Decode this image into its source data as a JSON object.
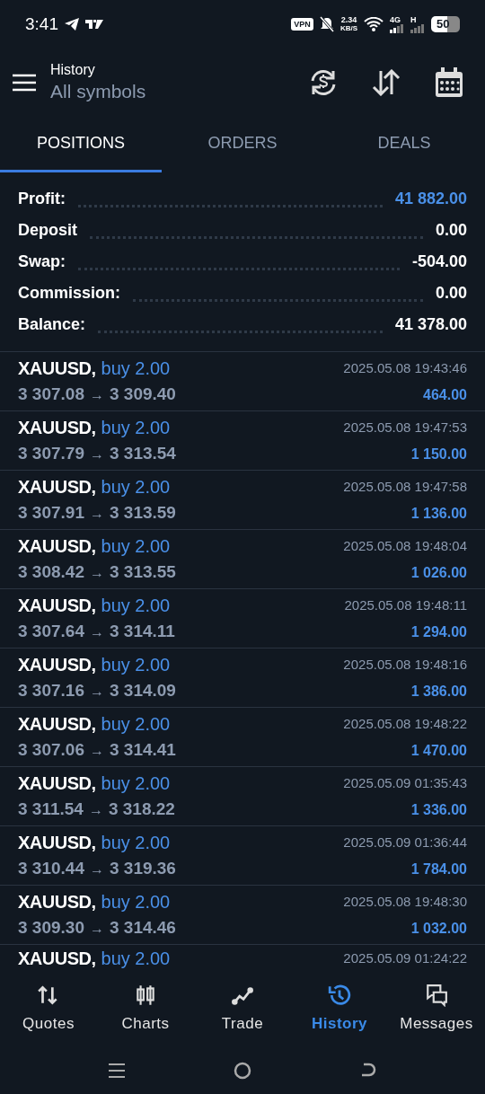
{
  "status_bar": {
    "time": "3:41",
    "vpn": "VPN",
    "speed": "2.34",
    "speed_unit": "KB/S",
    "network_1": "4G",
    "network_2": "H",
    "battery": "50"
  },
  "header": {
    "subtitle": "History",
    "title": "All symbols"
  },
  "tabs": [
    {
      "label": "POSITIONS",
      "selected": true
    },
    {
      "label": "ORDERS",
      "selected": false
    },
    {
      "label": "DEALS",
      "selected": false
    }
  ],
  "summary": [
    {
      "label": "Profit:",
      "value": "41 882.00",
      "highlight": true
    },
    {
      "label": "Deposit",
      "value": "0.00",
      "highlight": false
    },
    {
      "label": "Swap:",
      "value": "-504.00",
      "highlight": false
    },
    {
      "label": "Commission:",
      "value": "0.00",
      "highlight": false
    },
    {
      "label": "Balance:",
      "value": "41 378.00",
      "highlight": false
    }
  ],
  "positions": [
    {
      "symbol": "XAUUSD,",
      "side": "buy 2.00",
      "time": "2025.05.08 19:43:46",
      "open": "3 307.08",
      "arrow": "→",
      "close": "3 309.40",
      "profit": "464.00"
    },
    {
      "symbol": "XAUUSD,",
      "side": "buy 2.00",
      "time": "2025.05.08 19:47:53",
      "open": "3 307.79",
      "arrow": "→",
      "close": "3 313.54",
      "profit": "1 150.00"
    },
    {
      "symbol": "XAUUSD,",
      "side": "buy 2.00",
      "time": "2025.05.08 19:47:58",
      "open": "3 307.91",
      "arrow": "→",
      "close": "3 313.59",
      "profit": "1 136.00"
    },
    {
      "symbol": "XAUUSD,",
      "side": "buy 2.00",
      "time": "2025.05.08 19:48:04",
      "open": "3 308.42",
      "arrow": "→",
      "close": "3 313.55",
      "profit": "1 026.00"
    },
    {
      "symbol": "XAUUSD,",
      "side": "buy 2.00",
      "time": "2025.05.08 19:48:11",
      "open": "3 307.64",
      "arrow": "→",
      "close": "3 314.11",
      "profit": "1 294.00"
    },
    {
      "symbol": "XAUUSD,",
      "side": "buy 2.00",
      "time": "2025.05.08 19:48:16",
      "open": "3 307.16",
      "arrow": "→",
      "close": "3 314.09",
      "profit": "1 386.00"
    },
    {
      "symbol": "XAUUSD,",
      "side": "buy 2.00",
      "time": "2025.05.08 19:48:22",
      "open": "3 307.06",
      "arrow": "→",
      "close": "3 314.41",
      "profit": "1 470.00"
    },
    {
      "symbol": "XAUUSD,",
      "side": "buy 2.00",
      "time": "2025.05.09 01:35:43",
      "open": "3 311.54",
      "arrow": "→",
      "close": "3 318.22",
      "profit": "1 336.00"
    },
    {
      "symbol": "XAUUSD,",
      "side": "buy 2.00",
      "time": "2025.05.09 01:36:44",
      "open": "3 310.44",
      "arrow": "→",
      "close": "3 319.36",
      "profit": "1 784.00"
    },
    {
      "symbol": "XAUUSD,",
      "side": "buy 2.00",
      "time": "2025.05.08 19:48:30",
      "open": "3 309.30",
      "arrow": "→",
      "close": "3 314.46",
      "profit": "1 032.00"
    },
    {
      "symbol": "XAUUSD,",
      "side": "buy 2.00",
      "time": "2025.05.09 01:24:22"
    }
  ],
  "bottom_nav": [
    {
      "label": "Quotes",
      "selected": false
    },
    {
      "label": "Charts",
      "selected": false
    },
    {
      "label": "Trade",
      "selected": false
    },
    {
      "label": "History",
      "selected": true
    },
    {
      "label": "Messages",
      "selected": false
    }
  ]
}
